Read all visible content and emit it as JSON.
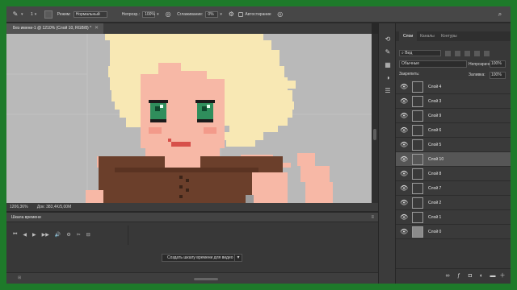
{
  "options_bar": {
    "tool_size": "1",
    "mode_label": "Режим:",
    "mode_value": "Нормальный",
    "opacity_label": "Непрозр.:",
    "opacity_value": "100%",
    "smoothing_label": "Сглаживание:",
    "smoothing_value": "0%",
    "autoerase_label": "Автостирание"
  },
  "document": {
    "tab_title": "Без имени-1 @ 1210% (Слой 10, RGB/8) *",
    "zoom": "1206,36%",
    "doc_size": "Док: 383,4K/5,00М"
  },
  "timeline": {
    "title": "Шкала времени",
    "create_button": "Создать шкалу времени для видео",
    "controls": [
      "⏮",
      "◀",
      "▶",
      "▶▶",
      "🔊",
      "⚙",
      "✂",
      "⊟"
    ]
  },
  "layers_panel": {
    "tabs": [
      "Слои",
      "Каналы",
      "Контуры"
    ],
    "active_tab": "Слои",
    "filter_label": "Вид",
    "blend_mode": "Обычные",
    "opacity_label": "Непрозрачность:",
    "opacity_value": "100%",
    "lock_label": "Закрепить:",
    "fill_label": "Заливка:",
    "fill_value": "100%",
    "layers": [
      {
        "name": "Слой 4",
        "selected": false,
        "thumb": "transparent"
      },
      {
        "name": "Слой 3",
        "selected": false,
        "thumb": "transparent"
      },
      {
        "name": "Слой 9",
        "selected": false,
        "thumb": "transparent"
      },
      {
        "name": "Слой 6",
        "selected": false,
        "thumb": "transparent"
      },
      {
        "name": "Слой 5",
        "selected": false,
        "thumb": "transparent"
      },
      {
        "name": "Слой 10",
        "selected": true,
        "thumb": "transparent"
      },
      {
        "name": "Слой 8",
        "selected": false,
        "thumb": "transparent"
      },
      {
        "name": "Слой 7",
        "selected": false,
        "thumb": "transparent"
      },
      {
        "name": "Слой 2",
        "selected": false,
        "thumb": "transparent"
      },
      {
        "name": "Слой 1",
        "selected": false,
        "thumb": "transparent"
      },
      {
        "name": "Слой 0",
        "selected": false,
        "thumb": "solid"
      }
    ]
  },
  "colors": {
    "background_frame": "#1e7a2a",
    "hair": "#f7e7b0",
    "skin": "#f5b3a2",
    "eye": "#2c8a5a",
    "dress": "#6a3e2a"
  }
}
